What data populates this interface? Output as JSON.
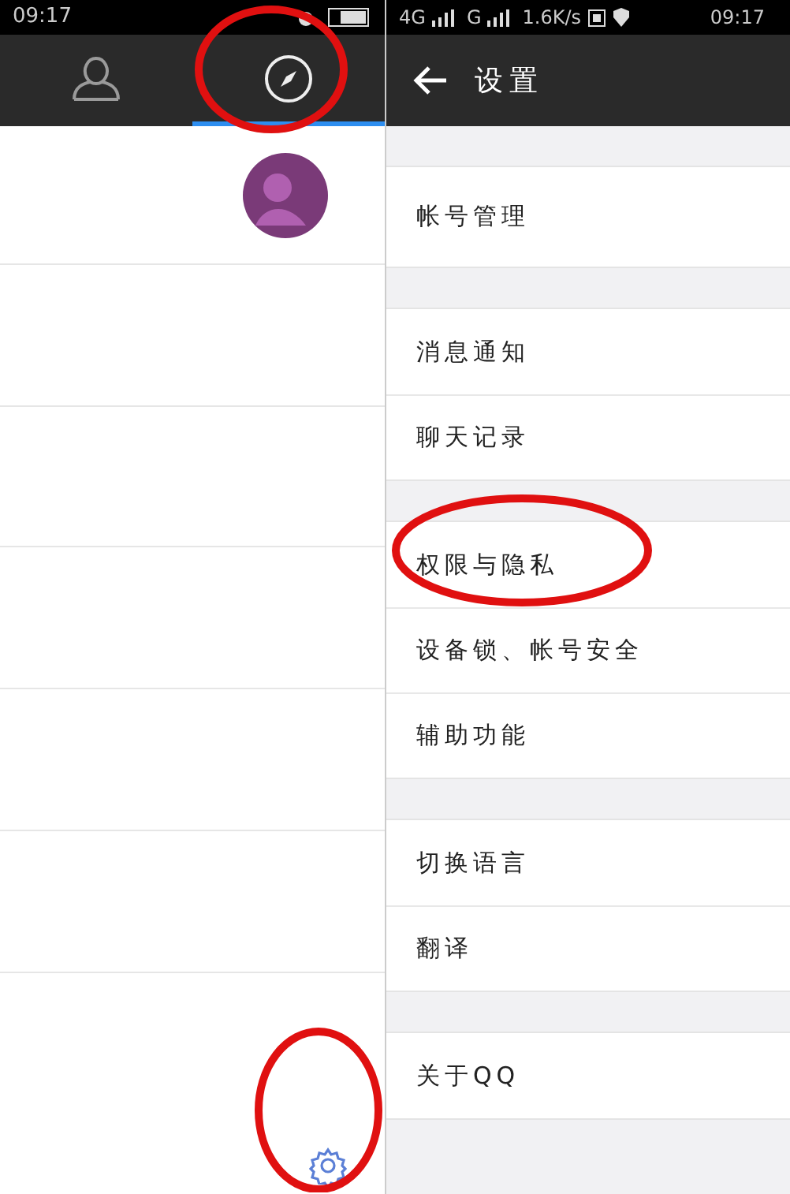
{
  "left": {
    "status_bar": {
      "time": "09:17"
    },
    "tabs": [
      {
        "kind": "contacts",
        "selected": false
      },
      {
        "kind": "discover",
        "selected": true
      }
    ]
  },
  "right": {
    "status_bar": {
      "network_1": "4G",
      "network_2": "G",
      "speed": "1.6K/s",
      "time": "09:17"
    },
    "title": "设置",
    "groups": [
      [
        "帐号管理"
      ],
      [
        "消息通知",
        "聊天记录"
      ],
      [
        "权限与隐私",
        "设备锁、帐号安全",
        "辅助功能"
      ],
      [
        "切换语言",
        "翻译"
      ],
      [
        "关于QQ"
      ]
    ]
  }
}
